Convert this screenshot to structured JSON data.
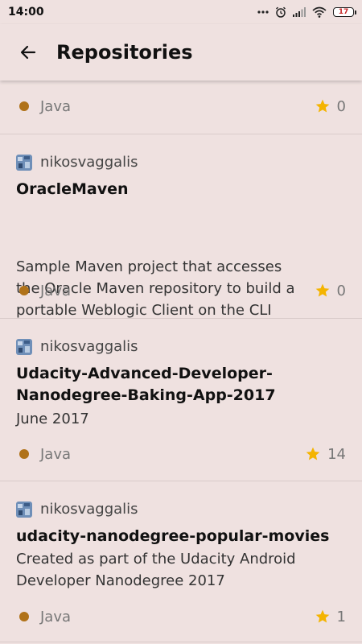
{
  "status_bar": {
    "time": "14:00",
    "battery": "17"
  },
  "app_bar": {
    "title": "Repositories"
  },
  "repos": [
    {
      "language": "Java",
      "stars": "0"
    },
    {
      "owner": "nikosvaggalis",
      "name": "OracleMaven",
      "description_lines": [
        "Sample Maven project that accesses",
        "the Oracle Maven repository to build a",
        "portable Weblogic Client on the CLI"
      ],
      "language": "Java",
      "stars": "0"
    },
    {
      "owner": "nikosvaggalis",
      "name_lines": [
        "Udacity-Advanced-Developer-",
        "Nanodegree-Baking-App-2017"
      ],
      "description": "June 2017",
      "language": "Java",
      "stars": "14"
    },
    {
      "owner": "nikosvaggalis",
      "name": "udacity-nanodegree-popular-movies",
      "description_lines": [
        "Created as part of the Udacity Android",
        "Developer Nanodegree 2017"
      ],
      "language": "Java",
      "stars": "1"
    }
  ],
  "colors": {
    "background": "#efe1e0",
    "java": "#b07219",
    "star": "#f4b400"
  },
  "icons": {
    "back": "arrow-left-icon",
    "star": "star-icon",
    "avatar": "owner-avatar"
  }
}
